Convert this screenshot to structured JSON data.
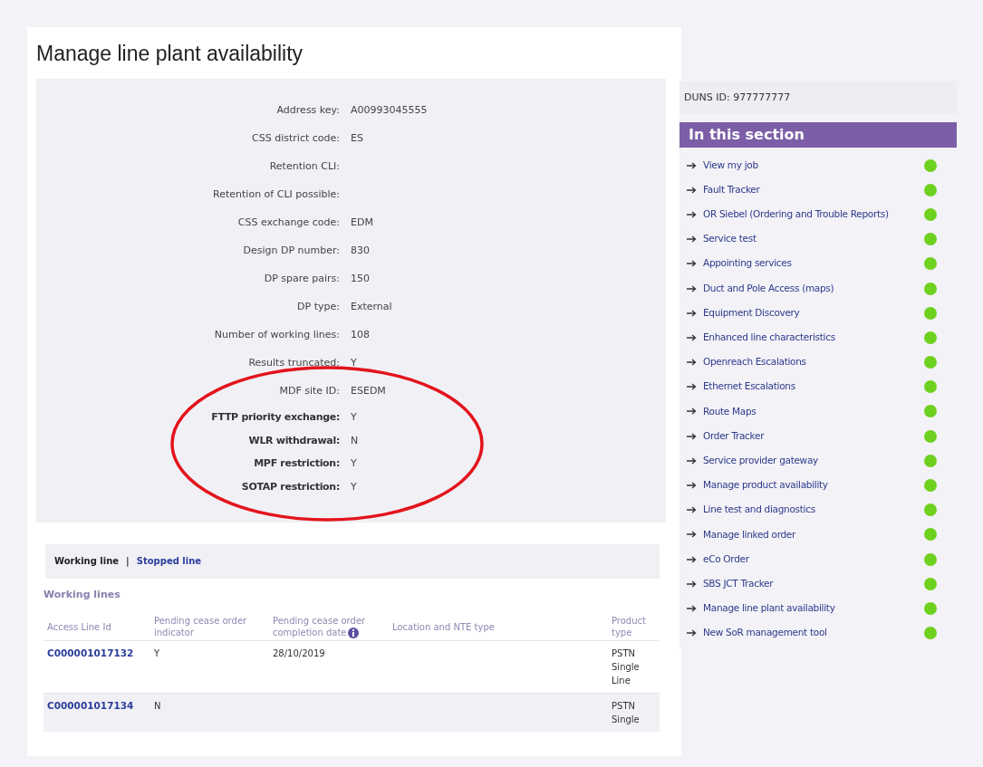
{
  "page": {
    "title": "Manage line plant availability"
  },
  "details": [
    {
      "label": "Address key:",
      "value": "A00993045555",
      "kind": "standard"
    },
    {
      "label": "CSS district code:",
      "value": "ES",
      "kind": "standard"
    },
    {
      "label": "Retention CLI:",
      "kind": "standard"
    },
    {
      "label": "Retention of CLI possible:",
      "kind": "standard"
    },
    {
      "label": "CSS exchange code:",
      "value": "EDM",
      "kind": "standard"
    },
    {
      "label": "Design DP number:",
      "value": "830",
      "kind": "standard"
    },
    {
      "label": "DP spare pairs:",
      "value": "150",
      "kind": "standard"
    },
    {
      "label": "DP type:",
      "value": "External",
      "kind": "standard"
    },
    {
      "label": "Number of working lines:",
      "value": "108",
      "kind": "standard"
    },
    {
      "label": "Results truncated:",
      "value": "Y",
      "kind": "standard"
    },
    {
      "label": "MDF site ID:",
      "value": "ESEDM",
      "kind": "site"
    },
    {
      "label": "FTTP priority exchange:",
      "value": "Y",
      "kind": "highlighted"
    },
    {
      "label": "WLR withdrawal:",
      "value": "N",
      "kind": "highlighted"
    },
    {
      "label": "MPF restriction:",
      "value": "Y",
      "kind": "highlighted"
    },
    {
      "label": "SOTAP restriction:",
      "value": "Y",
      "kind": "highlighted"
    }
  ],
  "annotations": [
    {
      "kind": "ellipse"
    }
  ],
  "line_tabs": {
    "separator": "|",
    "tabs": [
      {
        "label": "Working line",
        "selected": true
      },
      {
        "label": "Stopped line",
        "selected": false
      }
    ]
  },
  "working_lines": {
    "title": "Working lines",
    "columns": [
      {
        "label": "Access Line Id"
      },
      {
        "label": "Pending cease order indicator"
      },
      {
        "label": "Pending cease order completion date",
        "info": true
      },
      {
        "label": "Location and NTE type"
      },
      {
        "label": "Product type"
      }
    ],
    "rows": [
      {
        "access_line_id": "C000001017132",
        "indicator": "Y",
        "completion_date": "28/10/2019",
        "product_type": "PSTN Single Line"
      },
      {
        "access_line_id": "C000001017134",
        "indicator": "N",
        "product_type": "PSTN Single"
      }
    ]
  },
  "sidebar": {
    "duns": "DUNS ID: 977777777",
    "heading": "In this section",
    "items": [
      {
        "label": "View my job"
      },
      {
        "label": "Fault Tracker"
      },
      {
        "label": "OR Siebel (Ordering and Trouble Reports)"
      },
      {
        "label": "Service test"
      },
      {
        "label": "Appointing services"
      },
      {
        "label": "Duct and Pole Access (maps)"
      },
      {
        "label": "Equipment Discovery"
      },
      {
        "label": "Enhanced line characteristics"
      },
      {
        "label": "Openreach Escalations"
      },
      {
        "label": "Ethernet Escalations"
      },
      {
        "label": "Route Maps"
      },
      {
        "label": "Order Tracker"
      },
      {
        "label": "Service provider gateway"
      },
      {
        "label": "Manage product availability"
      },
      {
        "label": "Line test and diagnostics"
      },
      {
        "label": "Manage linked order"
      },
      {
        "label": "eCo Order"
      },
      {
        "label": "SBS JCT Tracker"
      },
      {
        "label": "Manage line plant availability"
      },
      {
        "label": "New SoR management tool"
      }
    ]
  }
}
